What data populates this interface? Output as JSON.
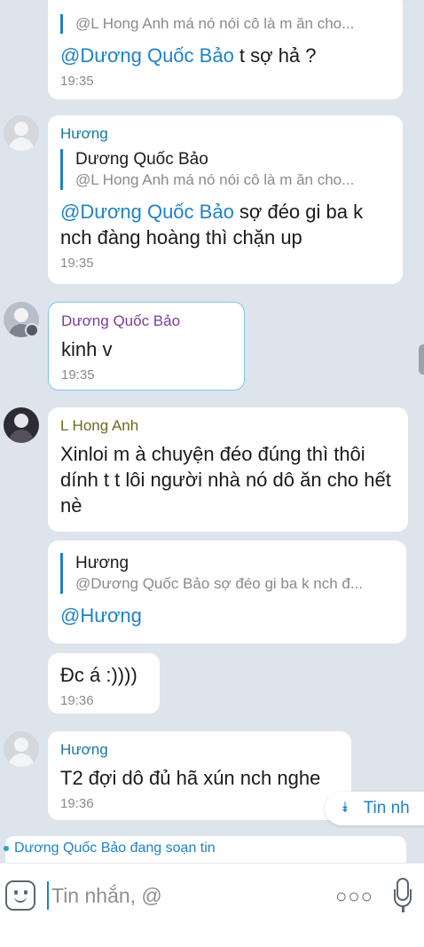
{
  "messages": [
    {
      "quote_text": "@L Hong Anh má nó nói cô là m ăn cho...",
      "mention": "@Dương Quốc Bảo",
      "text": " t sợ hả ?",
      "time": "19:35"
    },
    {
      "sender": "Hương",
      "quote_name": "Dương Quốc Bảo",
      "quote_text": "@L Hong Anh má nó nói cô là m ăn cho...",
      "mention": "@Dương Quốc Bảo",
      "text": " sợ đéo gi ba k nch đàng hoàng thì chặn up",
      "time": "19:35"
    },
    {
      "sender": "Dương Quốc Bảo",
      "text": "kinh v",
      "time": "19:35"
    },
    {
      "sender": "L Hong Anh",
      "text": "Xinloi m à chuyện đéo đúng thì thôi dính t t lôi người nhà nó dô ăn cho hết nè"
    },
    {
      "quote_name": "Hương",
      "quote_text": "@Dương Quốc Bảo sợ đéo gi ba k nch đ...",
      "mention": "@Hương"
    },
    {
      "text": "Đc á :))))",
      "time": "19:36"
    },
    {
      "sender": "Hương",
      "text": "T2 đợi dô đủ hã xún nch nghe",
      "time": "19:36"
    }
  ],
  "new_messages_pill": {
    "label": "Tin nh",
    "icon": "double-chevron-down-icon"
  },
  "typing_indicator": "Dương Quốc Bảo đang soạn tin",
  "input": {
    "placeholder": "Tin nhắn, @",
    "value": ""
  },
  "colors": {
    "background": "#dde4ec",
    "accent": "#1e82c6",
    "sender_teal": "#167a9a",
    "sender_purple": "#7a3d9a",
    "sender_olive": "#6f6a1e"
  }
}
